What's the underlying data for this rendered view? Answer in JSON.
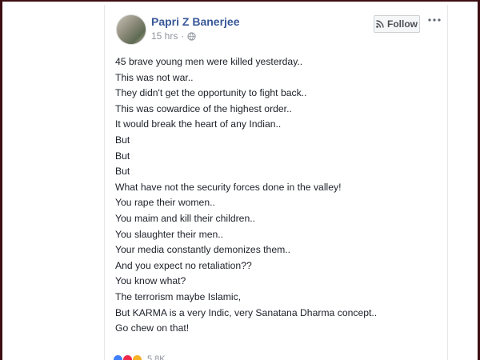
{
  "post": {
    "author": "Papri Z Banerjee",
    "time": "15 hrs",
    "dot": "·",
    "audience_icon": "globe-icon",
    "follow_label": "Follow",
    "follow_icon": "rss-icon",
    "more_icon": "more-horizontal-icon",
    "lines": [
      "45 brave young men were killed yesterday..",
      "This was not war..",
      "They didn't get the opportunity to fight back..",
      "This was cowardice of the highest order..",
      "It would break the heart of any Indian..",
      "But",
      "But",
      "But",
      "What have not the security forces done in the valley!",
      "You rape their women..",
      "You maim and kill their children..",
      "You slaughter their men..",
      "Your media constantly demonizes them..",
      "And you expect no retaliation??",
      "You know what?",
      "The terrorism maybe Islamic,",
      "But KARMA is a very Indic, very Sanatana Dharma concept..",
      "Go chew on that!"
    ],
    "reactions": {
      "icons": [
        "like-icon",
        "love-icon",
        "haha-icon"
      ],
      "count": "5.8K"
    }
  },
  "colors": {
    "author": "#385898",
    "text": "#1d2129",
    "meta": "#90949c",
    "frame": "#3d0e12"
  }
}
